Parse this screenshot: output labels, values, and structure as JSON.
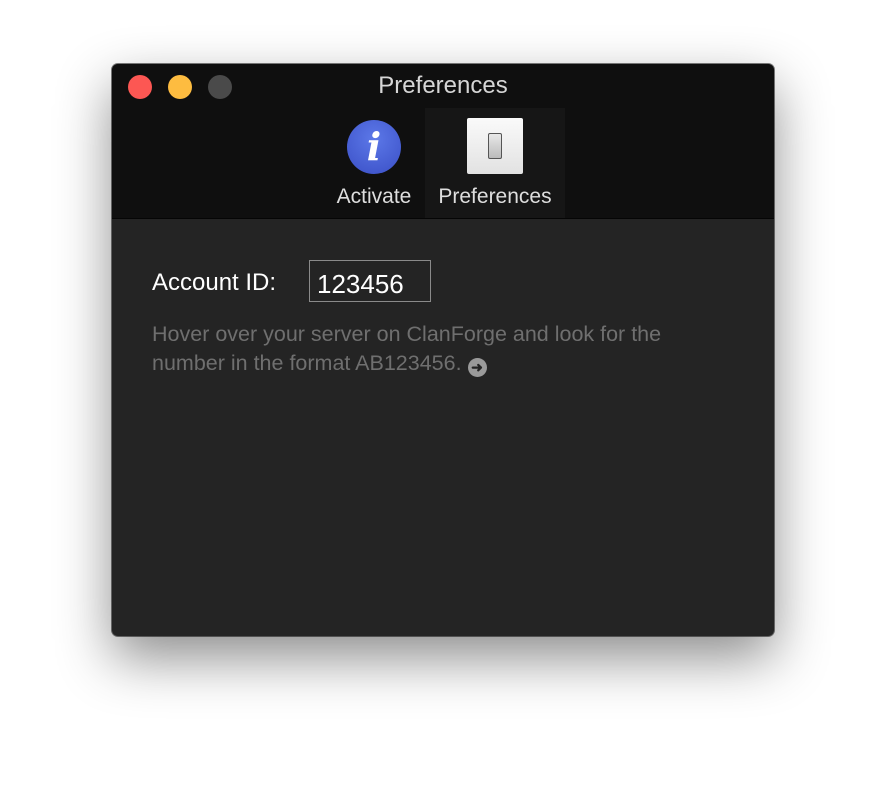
{
  "window": {
    "title": "Preferences"
  },
  "toolbar": {
    "items": [
      {
        "label": "Activate",
        "icon": "info-icon",
        "selected": false
      },
      {
        "label": "Preferences",
        "icon": "switch-icon",
        "selected": true
      }
    ]
  },
  "form": {
    "account_label": "Account ID:",
    "account_value": "123456",
    "help_text": "Hover over your server on ClanForge and look for the number in the format AB123456.",
    "help_link_icon": "arrow-right-circle-icon"
  },
  "colors": {
    "close": "#fc5753",
    "minimize": "#fdbc40",
    "zoom": "#4a4a4a",
    "info": "#4a63d8"
  }
}
